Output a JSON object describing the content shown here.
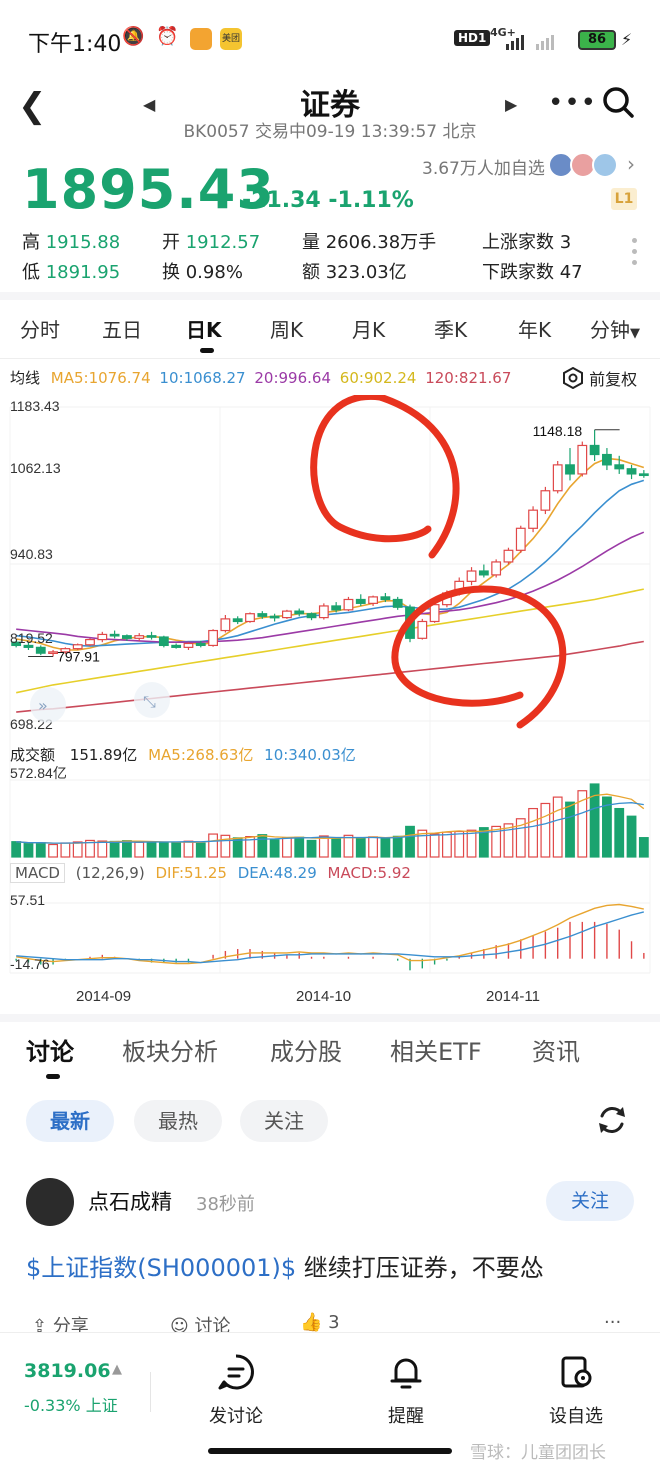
{
  "status_bar": {
    "time": "下午1:40",
    "pill1": "美团",
    "signal": "HD1",
    "net": "4G+",
    "battery": "86"
  },
  "header": {
    "title": "证券",
    "subtitle": "BK0057 交易中09-19 13:39:57 北京"
  },
  "quote": {
    "price": "1895.43",
    "change": "-21.34",
    "change_pct": "-1.11%",
    "watchers": "3.67万人加自选",
    "level_badge": "L1",
    "stats": {
      "high_label": "高",
      "high": "1915.88",
      "low_label": "低",
      "low": "1891.95",
      "open_label": "开",
      "open": "1912.57",
      "turnover_label": "换",
      "turnover": "0.98%",
      "volume_label": "量",
      "volume": "2606.38万手",
      "amount_label": "额",
      "amount": "323.03亿",
      "rise_label": "上涨家数",
      "rise": "3",
      "fall_label": "下跌家数",
      "fall": "47"
    }
  },
  "ktabs": [
    "分时",
    "五日",
    "日K",
    "周K",
    "月K",
    "季K",
    "年K",
    "分钟"
  ],
  "ma": {
    "label": "均线",
    "ma5": "MA5:1076.74",
    "ma10": "10:1068.27",
    "ma20": "20:996.64",
    "ma60": "60:902.24",
    "ma120": "120:821.67",
    "fuquan": "前复权"
  },
  "chart_data": {
    "type": "candlestick",
    "price_axis": {
      "max": 1183.43,
      "mid1": 1062.13,
      "mid2": 940.83,
      "mid3": 819.52,
      "min": 698.22
    },
    "y_tick_labels": [
      "1183.43",
      "1062.13",
      "940.83",
      "819.52",
      "698.22"
    ],
    "high_marker": "1148.18",
    "low_marker": "797.91",
    "x_tick_labels": [
      "2014-09",
      "2014-10",
      "2014-11"
    ],
    "ohlc": [
      [
        820,
        822,
        812,
        815
      ],
      [
        815,
        820,
        808,
        812
      ],
      [
        812,
        815,
        800,
        803
      ],
      [
        803,
        808,
        797.91,
        805
      ],
      [
        805,
        812,
        802,
        810
      ],
      [
        810,
        818,
        808,
        816
      ],
      [
        816,
        826,
        814,
        824
      ],
      [
        824,
        836,
        820,
        832
      ],
      [
        832,
        838,
        826,
        830
      ],
      [
        830,
        832,
        822,
        826
      ],
      [
        826,
        834,
        822,
        830
      ],
      [
        830,
        836,
        824,
        828
      ],
      [
        828,
        830,
        812,
        815
      ],
      [
        815,
        818,
        810,
        812
      ],
      [
        812,
        820,
        808,
        818
      ],
      [
        818,
        822,
        812,
        815
      ],
      [
        815,
        840,
        813,
        838
      ],
      [
        838,
        862,
        835,
        856
      ],
      [
        856,
        860,
        848,
        852
      ],
      [
        852,
        866,
        850,
        864
      ],
      [
        864,
        868,
        856,
        860
      ],
      [
        860,
        864,
        852,
        858
      ],
      [
        858,
        870,
        856,
        868
      ],
      [
        868,
        872,
        860,
        864
      ],
      [
        864,
        866,
        854,
        858
      ],
      [
        858,
        880,
        855,
        876
      ],
      [
        876,
        882,
        866,
        870
      ],
      [
        870,
        890,
        868,
        886
      ],
      [
        886,
        894,
        876,
        880
      ],
      [
        880,
        892,
        876,
        890
      ],
      [
        890,
        896,
        882,
        886
      ],
      [
        886,
        890,
        870,
        874
      ],
      [
        874,
        878,
        820,
        826
      ],
      [
        826,
        856,
        824,
        852
      ],
      [
        852,
        882,
        850,
        878
      ],
      [
        878,
        900,
        874,
        896
      ],
      [
        896,
        920,
        892,
        914
      ],
      [
        914,
        936,
        908,
        930
      ],
      [
        930,
        940,
        920,
        924
      ],
      [
        924,
        948,
        920,
        944
      ],
      [
        944,
        966,
        940,
        962
      ],
      [
        962,
        1000,
        958,
        996
      ],
      [
        996,
        1030,
        990,
        1024
      ],
      [
        1024,
        1060,
        1018,
        1054
      ],
      [
        1054,
        1100,
        1050,
        1094
      ],
      [
        1094,
        1120,
        1070,
        1080
      ],
      [
        1080,
        1130,
        1076,
        1124
      ],
      [
        1124,
        1148.18,
        1100,
        1110
      ],
      [
        1110,
        1120,
        1086,
        1094
      ],
      [
        1094,
        1108,
        1080,
        1088
      ],
      [
        1088,
        1094,
        1072,
        1080
      ],
      [
        1080,
        1086,
        1074,
        1078
      ]
    ],
    "series": [
      {
        "name": "MA5",
        "values": [
          825,
          822,
          818,
          812,
          808,
          808,
          811,
          816,
          822,
          826,
          828,
          829,
          827,
          823,
          820,
          816,
          820,
          832,
          844,
          854,
          858,
          860,
          861,
          864,
          864,
          866,
          868,
          872,
          876,
          880,
          884,
          884,
          872,
          864,
          862,
          866,
          880,
          898,
          912,
          926,
          940,
          960,
          980,
          1004,
          1034,
          1060,
          1080,
          1096,
          1104,
          1102,
          1096,
          1090
        ]
      },
      {
        "name": "MA10",
        "values": [
          830,
          828,
          825,
          822,
          818,
          815,
          814,
          815,
          816,
          817,
          818,
          819,
          820,
          820,
          821,
          821,
          823,
          826,
          830,
          836,
          842,
          848,
          853,
          858,
          861,
          862,
          864,
          866,
          869,
          872,
          875,
          876,
          874,
          872,
          871,
          871,
          874,
          880,
          886,
          894,
          902,
          914,
          928,
          944,
          962,
          982,
          1000,
          1020,
          1038,
          1054,
          1064,
          1070
        ]
      },
      {
        "name": "MA20",
        "values": [
          840,
          838,
          836,
          834,
          832,
          829,
          827,
          825,
          824,
          823,
          822,
          821,
          820,
          820,
          820,
          820,
          821,
          822,
          823,
          825,
          827,
          830,
          833,
          836,
          839,
          842,
          845,
          848,
          851,
          854,
          857,
          860,
          862,
          864,
          866,
          868,
          870,
          873,
          877,
          881,
          886,
          892,
          899,
          907,
          916,
          926,
          937,
          949,
          961,
          972,
          982,
          990
        ]
      },
      {
        "name": "MA60",
        "values": [
          742,
          746,
          750,
          754,
          757,
          760,
          763,
          766,
          769,
          772,
          775,
          778,
          781,
          784,
          787,
          790,
          793,
          796,
          799,
          802,
          805,
          808,
          811,
          814,
          817,
          820,
          823,
          826,
          829,
          832,
          835,
          838,
          841,
          844,
          847,
          850,
          853,
          856,
          859,
          862,
          865,
          868,
          871,
          874,
          877,
          880,
          883,
          886,
          890,
          894,
          898,
          902
        ]
      },
      {
        "name": "MA120",
        "values": [
          712,
          714,
          716,
          717,
          719,
          721,
          723,
          725,
          727,
          729,
          731,
          733,
          735,
          737,
          739,
          741,
          743,
          745,
          747,
          749,
          751,
          753,
          755,
          757,
          759,
          761,
          763,
          765,
          767,
          769,
          771,
          773,
          775,
          777,
          779,
          781,
          783,
          785,
          787,
          789,
          791,
          793,
          795,
          797,
          799,
          802,
          805,
          808,
          811,
          814,
          818,
          821
        ]
      }
    ],
    "volume": {
      "label": "成交额",
      "current": "151.89亿",
      "ma5": "MA5:268.63亿",
      "ma10": "10:340.03亿",
      "max_label": "572.84亿",
      "max": 572.84,
      "values": [
        120,
        105,
        112,
        98,
        110,
        118,
        130,
        125,
        122,
        128,
        115,
        118,
        110,
        112,
        124,
        108,
        180,
        170,
        150,
        160,
        175,
        135,
        150,
        155,
        130,
        165,
        140,
        170,
        150,
        158,
        145,
        162,
        240,
        210,
        180,
        195,
        200,
        210,
        230,
        240,
        260,
        300,
        380,
        420,
        470,
        430,
        520,
        572.84,
        470,
        380,
        320,
        151.89
      ]
    },
    "macd": {
      "label": "MACD",
      "params": "(12,26,9)",
      "dif": "DIF:51.25",
      "dea": "DEA:48.29",
      "macd": "MACD:5.92",
      "max_label": "57.51",
      "min_label": "-14.76",
      "max": 57.51,
      "min": -14.76,
      "dif_values": [
        2,
        0,
        -2,
        -3,
        -2,
        -1,
        0,
        1,
        1,
        0,
        -2,
        -3,
        -4,
        -5,
        -5,
        -4,
        -1,
        2,
        4,
        6,
        6,
        6,
        6,
        7,
        6,
        6,
        5,
        6,
        5,
        6,
        5,
        4,
        -2,
        -2,
        -1,
        1,
        3,
        6,
        9,
        12,
        15,
        19,
        24,
        29,
        35,
        42,
        47,
        52,
        55,
        56,
        54,
        51.25
      ],
      "dea_values": [
        3,
        2,
        1,
        0,
        -1,
        -1,
        -1,
        -1,
        0,
        0,
        -1,
        -1,
        -2,
        -3,
        -3,
        -4,
        -3,
        -2,
        -1,
        1,
        2,
        3,
        4,
        4,
        5,
        5,
        5,
        5,
        5,
        5,
        5,
        5,
        4,
        3,
        2,
        2,
        2,
        3,
        4,
        5,
        7,
        9,
        12,
        15,
        19,
        23,
        28,
        33,
        37,
        41,
        45,
        48.29
      ],
      "hist_values": [
        -2,
        -4,
        -6,
        -6,
        -2,
        0,
        2,
        4,
        2,
        0,
        -2,
        -4,
        -4,
        -4,
        -4,
        0,
        4,
        8,
        10,
        10,
        8,
        6,
        4,
        6,
        2,
        2,
        0,
        2,
        0,
        2,
        0,
        -2,
        -12,
        -10,
        -6,
        -2,
        2,
        6,
        10,
        14,
        16,
        20,
        24,
        28,
        32,
        38,
        38,
        38,
        36,
        30,
        18,
        5.92
      ]
    },
    "annotation": "red hand-drawn circles"
  },
  "content_tabs": [
    "讨论",
    "板块分析",
    "成分股",
    "相关ETF",
    "资讯"
  ],
  "filters": [
    "最新",
    "最热",
    "关注"
  ],
  "post": {
    "author": "点石成精",
    "time": "38秒前",
    "follow": "关注",
    "link_text": "$上证指数(SH000001)$",
    "text": " 继续打压证券，不要怂",
    "share": "分享",
    "comment": "讨论",
    "likes": "3"
  },
  "bottom": {
    "index_value": "3819.06",
    "index_change": "-0.33% 上证",
    "btn1": "发讨论",
    "btn2": "提醒",
    "btn3": "设自选",
    "watermark": "雪球：儿童团团长"
  },
  "colors": {
    "green": "#1aa36f",
    "red": "#e04848",
    "blue_link": "#2d6fc6",
    "ma5": "#e8a530",
    "ma10": "#3a8fd0",
    "ma20": "#9b3aa6",
    "ma60": "#e6cf2a",
    "ma120": "#c94a5a"
  }
}
